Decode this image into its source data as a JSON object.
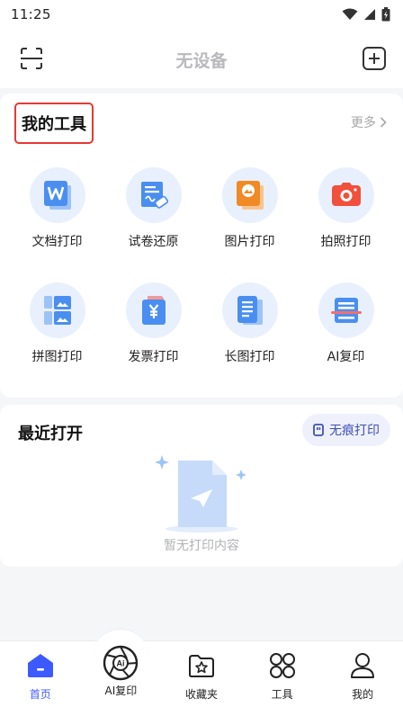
{
  "status": {
    "time": "11:25"
  },
  "header": {
    "title": "无设备"
  },
  "tools": {
    "title": "我的工具",
    "more_label": "更多",
    "items": [
      {
        "label": "文档打印",
        "icon": "word-document-icon"
      },
      {
        "label": "试卷还原",
        "icon": "exam-paper-icon"
      },
      {
        "label": "图片打印",
        "icon": "image-icon"
      },
      {
        "label": "拍照打印",
        "icon": "camera-icon"
      },
      {
        "label": "拼图打印",
        "icon": "collage-icon"
      },
      {
        "label": "发票打印",
        "icon": "invoice-icon"
      },
      {
        "label": "长图打印",
        "icon": "long-image-icon"
      },
      {
        "label": "AI复印",
        "icon": "ai-copy-icon"
      }
    ]
  },
  "recent": {
    "title": "最近打开",
    "incognito_label": "无痕打印",
    "empty_text": "暂无打印内容"
  },
  "nav": {
    "items": [
      {
        "label": "首页",
        "icon": "home-icon",
        "active": true
      },
      {
        "label": "AI复印",
        "icon": "ai-aperture-icon",
        "active": false
      },
      {
        "label": "收藏夹",
        "icon": "favorites-folder-icon",
        "active": false
      },
      {
        "label": "工具",
        "icon": "tools-grid-icon",
        "active": false
      },
      {
        "label": "我的",
        "icon": "profile-icon",
        "active": false
      }
    ]
  },
  "colors": {
    "accent": "#3d5afe",
    "tool_circle_bg": "#e9f0fd",
    "highlight_border": "#e53935",
    "tool_blue": "#4a8ff0",
    "tool_orange": "#f08a24",
    "tool_red": "#f0503c"
  }
}
